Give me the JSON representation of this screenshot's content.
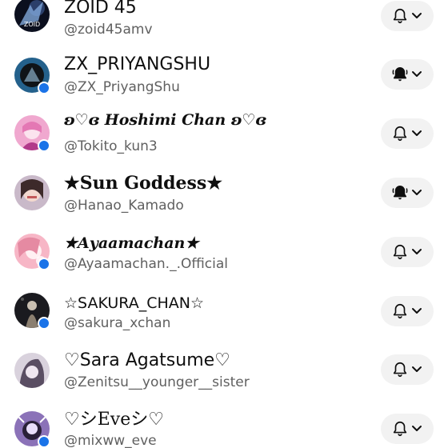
{
  "channels": [
    {
      "name": "ZOID 45",
      "handle": "@zoid45amv",
      "avatar_label": "ZOID",
      "bell": "outline",
      "live_dot": false,
      "avatar_colors": [
        "#0b0f1e",
        "#7fa6d8"
      ]
    },
    {
      "name": "ZX_PRIYANGSHU",
      "handle": "@ZX_PriyangShu",
      "bell": "filled",
      "live_dot": true,
      "avatar_colors": [
        "#24618c",
        "#101418"
      ]
    },
    {
      "name": "ʚ♡ɞ 𝑯𝒐𝒔𝒉𝒊𝒎𝒊 𝑪𝒉𝒂𝒏 ʚ♡ɞ",
      "handle": "@Tokito_kun3",
      "bell": "outline",
      "live_dot": true,
      "avatar_colors": [
        "#f0a8cf",
        "#b23a8a"
      ]
    },
    {
      "name": "★Sun Goddess★",
      "handle": "@Hanao_Kamado",
      "bell": "filled",
      "live_dot": false,
      "avatar_colors": [
        "#c9b9c9",
        "#3d2a2a"
      ]
    },
    {
      "name": "★𝑨𝒚𝒂𝒂𝒎𝒂𝒄𝒉𝒂𝒏★",
      "handle": "@Ayaamachan._.Official",
      "bell": "outline",
      "live_dot": true,
      "avatar_colors": [
        "#f7b6c6",
        "#e58aa2"
      ]
    },
    {
      "name": "☆SAKURA_CHAN☆",
      "handle": "@sakura_xchan",
      "bell": "outline",
      "live_dot": true,
      "avatar_colors": [
        "#1a1a1f",
        "#8b7f70"
      ]
    },
    {
      "name": "♡Sara Agatsume♡",
      "handle": "@Zenitsu__younger__sister",
      "bell": "outline",
      "live_dot": false,
      "avatar_colors": [
        "#d9d2dd",
        "#5a4e63"
      ]
    },
    {
      "name": "♡シEveシ♡",
      "handle": "@mixww_eve",
      "bell": "outline",
      "live_dot": true,
      "avatar_colors": [
        "#8b72b8",
        "#2a2038"
      ]
    }
  ],
  "icons": {
    "bell_outline": "bell-icon",
    "bell_filled": "bell-all-icon",
    "chevron": "chevron-down-icon"
  },
  "colors": {
    "status_dot": "#1a73e8",
    "button_bg": "#f2f2f2",
    "text_primary": "#0f0f0f",
    "text_secondary": "#606060"
  }
}
